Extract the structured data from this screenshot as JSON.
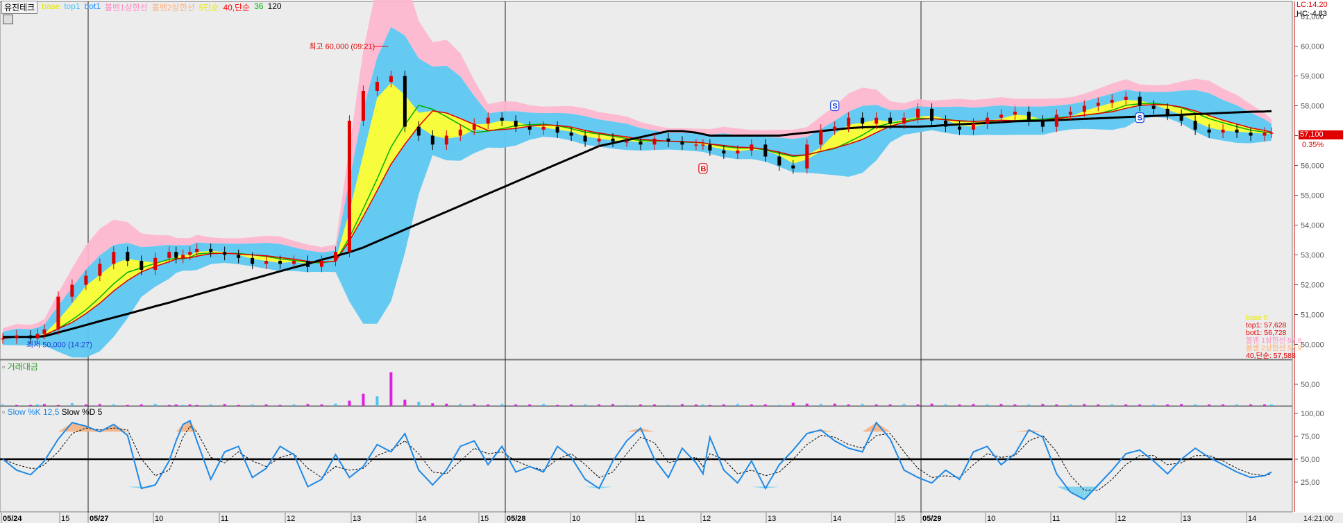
{
  "header": {
    "stock_name": "유진테크",
    "legend": [
      {
        "label": "base",
        "color": "#e8e800"
      },
      {
        "label": "top1",
        "color": "#4cc3f5"
      },
      {
        "label": "bot1",
        "color": "#1e90ff"
      },
      {
        "label": "볼밴1상한선",
        "color": "#ff8cc0"
      },
      {
        "label": "볼밴2상한선",
        "color": "#ffb07a"
      },
      {
        "label": "5단순",
        "color": "#e8e800"
      },
      {
        "label": "40,단순",
        "color": "#ff0000"
      },
      {
        "label": "36",
        "color": "#00b000"
      },
      {
        "label": "120",
        "color": "#000000"
      }
    ]
  },
  "right_info": {
    "lc": "LC:14.20",
    "hc": "HC:-4.83"
  },
  "price_panel": {
    "axis_ticks": [
      "61,000",
      "60,000",
      "59,000",
      "58,000",
      "57,000",
      "56,000",
      "55,000",
      "54,000",
      "53,000",
      "52,000",
      "51,000",
      "50,000"
    ],
    "current_price": "57,100",
    "change_pct": "0.35%",
    "high_annotation": "최고 60,000 (09:21)",
    "low_annotation": "최저 50,000 (14:27)",
    "values_box": [
      {
        "label": "base",
        "value": "0",
        "color": "#e8e800"
      },
      {
        "label": "top1:",
        "value": "57,628",
        "color": "#e00000"
      },
      {
        "label": "bot1:",
        "value": "56,728",
        "color": "#e00000"
      },
      {
        "label": "볼밴 1상한선",
        "value": "57,8",
        "color": "#ff8cc0"
      },
      {
        "label": "볼밴 2상한선",
        "value": "57,9",
        "color": "#ffb07a"
      },
      {
        "label": "40,단순:",
        "value": "57,588",
        "color": "#e00000"
      }
    ],
    "markers": [
      {
        "label": "S",
        "color": "#1a3fd6"
      },
      {
        "label": "S",
        "color": "#1a3fd6"
      },
      {
        "label": "B",
        "color": "#e00000"
      }
    ]
  },
  "volume_panel": {
    "title": "거래대금",
    "axis_ticks": [
      "50,00"
    ]
  },
  "stoch_panel": {
    "title_k": "Slow %K 12,5",
    "title_d": "Slow %D 5",
    "axis_ticks": [
      "100,00",
      "75,00",
      "50,00",
      "25,00"
    ]
  },
  "time_axis": {
    "labels": [
      "05/24",
      "15",
      "05/27",
      "10",
      "11",
      "12",
      "13",
      "14",
      "15",
      "05/28",
      "10",
      "11",
      "12",
      "13",
      "14",
      "15",
      "05/29",
      "10",
      "11",
      "12",
      "13",
      "14"
    ],
    "clock": "14:21:00"
  },
  "chart_data": [
    {
      "type": "line",
      "title": "유진테크",
      "ylim": [
        49500,
        61500
      ],
      "x": [
        0,
        20,
        40,
        50,
        60,
        80,
        100,
        120,
        140,
        160,
        180,
        200,
        220,
        240,
        250,
        260,
        270,
        280,
        300,
        320,
        340,
        360,
        380,
        400,
        420,
        440,
        460,
        480,
        500,
        520,
        540,
        560,
        580,
        600,
        620,
        640,
        660,
        680,
        700,
        720,
        740,
        760,
        780,
        800,
        820,
        840,
        860,
        880,
        900,
        920,
        940,
        960,
        980,
        1000,
        1010,
        1020,
        1040,
        1060,
        1080,
        1100,
        1120,
        1140,
        1160,
        1180,
        1200,
        1220,
        1240,
        1260,
        1280,
        1300,
        1320,
        1340,
        1360,
        1380,
        1400,
        1420,
        1440,
        1460,
        1480,
        1500,
        1520,
        1540,
        1560,
        1580,
        1600,
        1620,
        1640,
        1660,
        1680,
        1700,
        1720,
        1740,
        1760,
        1780,
        1800,
        1820,
        1830
      ],
      "series": [
        {
          "name": "close",
          "values": [
            50200,
            50300,
            50200,
            50350,
            50500,
            51600,
            52000,
            52300,
            52700,
            53100,
            52800,
            52500,
            52900,
            53100,
            52900,
            53000,
            53100,
            53200,
            53100,
            53000,
            52900,
            52700,
            52800,
            52700,
            52800,
            52600,
            52800,
            53100,
            57500,
            58500,
            58800,
            59000,
            57300,
            57000,
            56700,
            57000,
            57200,
            57400,
            57600,
            57500,
            57300,
            57200,
            57300,
            57100,
            57000,
            56800,
            56900,
            56800,
            56800,
            56700,
            56900,
            56800,
            56700,
            56700,
            56700,
            56500,
            56400,
            56500,
            56700,
            56300,
            56000,
            55900,
            56700,
            57200,
            57300,
            57600,
            57400,
            57600,
            57400,
            57600,
            57900,
            57500,
            57300,
            57200,
            57400,
            57600,
            57700,
            57800,
            57500,
            57300,
            57700,
            57800,
            58000,
            58100,
            58200,
            58300,
            58000,
            57900,
            57700,
            57500,
            57200,
            57100,
            57200,
            57100,
            57000,
            57100,
            57100
          ]
        },
        {
          "name": "120",
          "values": [
            50250,
            50250,
            50250,
            50260,
            50270,
            50400,
            50520,
            50650,
            50780,
            50900,
            51020,
            51150,
            51280,
            51400,
            51470,
            51540,
            51600,
            51670,
            51800,
            51930,
            52060,
            52190,
            52320,
            52450,
            52580,
            52700,
            52840,
            52960,
            53090,
            53250,
            53450,
            53650,
            53850,
            54050,
            54250,
            54450,
            54650,
            54850,
            55050,
            55250,
            55450,
            55650,
            55850,
            56050,
            56250,
            56450,
            56650,
            56750,
            56850,
            56950,
            57050,
            57150,
            57150,
            57100,
            57050,
            57000,
            57000,
            57000,
            57000,
            57000,
            57000,
            57050,
            57100,
            57150,
            57200,
            57250,
            57280,
            57290,
            57300,
            57300,
            57300,
            57320,
            57350,
            57380,
            57400,
            57420,
            57450,
            57480,
            57490,
            57500,
            57520,
            57540,
            57560,
            57580,
            57600,
            57620,
            57640,
            57660,
            57680,
            57700,
            57720,
            57740,
            57760,
            57780,
            57800,
            57810,
            57820
          ]
        }
      ]
    },
    {
      "type": "bar",
      "title": "거래대금",
      "ylim": [
        0,
        100
      ],
      "values": [
        3,
        2,
        2,
        3,
        4,
        2,
        6,
        3,
        4,
        3,
        2,
        3,
        4,
        2,
        3,
        2,
        3,
        2,
        3,
        4,
        2,
        3,
        3,
        2,
        3,
        4,
        3,
        5,
        12,
        28,
        22,
        78,
        14,
        9,
        6,
        5,
        4,
        4,
        3,
        4,
        3,
        3,
        4,
        2,
        3,
        3,
        3,
        4,
        2,
        3,
        3,
        2,
        4,
        3,
        3,
        2,
        3,
        4,
        3,
        3,
        2,
        7,
        5,
        4,
        5,
        3,
        4,
        3,
        3,
        4,
        3,
        5,
        3,
        3,
        4,
        3,
        4,
        3,
        3,
        4,
        3,
        3,
        4,
        3,
        3,
        3,
        3,
        3,
        3,
        4,
        3,
        3,
        3,
        3,
        3,
        3,
        3
      ]
    },
    {
      "type": "line",
      "title": "Slow %K 12,5",
      "ylim": [
        0,
        100
      ],
      "series": [
        {
          "name": "Slow %K 12,5",
          "values": [
            50,
            38,
            33,
            40,
            48,
            72,
            90,
            86,
            80,
            88,
            76,
            18,
            22,
            48,
            70,
            88,
            92,
            70,
            28,
            58,
            64,
            30,
            40,
            64,
            55,
            20,
            28,
            55,
            30,
            42,
            66,
            58,
            78,
            38,
            22,
            38,
            64,
            70,
            44,
            64,
            36,
            42,
            36,
            64,
            52,
            28,
            18,
            48,
            70,
            84,
            50,
            30,
            62,
            46,
            34,
            74,
            38,
            24,
            48,
            18,
            44,
            60,
            78,
            82,
            70,
            62,
            58,
            90,
            72,
            38,
            30,
            24,
            38,
            28,
            58,
            64,
            44,
            56,
            82,
            74,
            34,
            14,
            6,
            22,
            38,
            56,
            60,
            48,
            34,
            50,
            62,
            52,
            44,
            36,
            30,
            32,
            36
          ]
        },
        {
          "name": "Slow %D 5",
          "values": [
            50,
            44,
            40,
            40,
            44,
            58,
            78,
            84,
            82,
            84,
            82,
            50,
            32,
            38,
            55,
            74,
            86,
            80,
            52,
            46,
            58,
            48,
            42,
            52,
            56,
            40,
            30,
            42,
            38,
            40,
            54,
            60,
            70,
            56,
            36,
            34,
            48,
            62,
            56,
            58,
            48,
            42,
            38,
            50,
            56,
            44,
            30,
            36,
            56,
            74,
            68,
            46,
            50,
            52,
            42,
            56,
            50,
            34,
            38,
            32,
            36,
            50,
            66,
            76,
            74,
            66,
            62,
            76,
            78,
            58,
            40,
            30,
            32,
            30,
            44,
            56,
            52,
            54,
            70,
            76,
            58,
            32,
            16,
            16,
            28,
            44,
            54,
            54,
            44,
            46,
            54,
            54,
            48,
            40,
            34,
            32,
            34
          ]
        }
      ]
    }
  ]
}
